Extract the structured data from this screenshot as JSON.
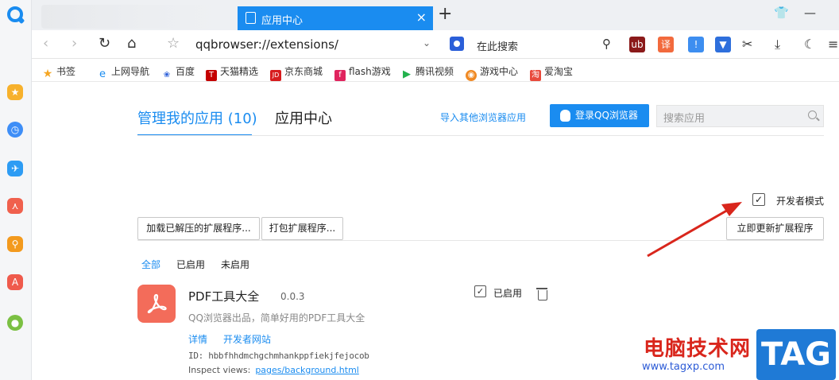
{
  "tab": {
    "title": "应用中心",
    "close": "×",
    "new_tab": "+"
  },
  "window_controls": {
    "skin": "👕",
    "minimize": "—"
  },
  "address": {
    "url": "qqbrowser://extensions/",
    "search_placeholder": "在此搜索",
    "dropdown": "⌄"
  },
  "toolbar": {
    "translate_label": "译"
  },
  "bookmarks": [
    {
      "label": "书签",
      "icon": "star-icon",
      "color": "#f5a623"
    },
    {
      "label": "上网导航",
      "icon": "e-icon",
      "color": "#1a8cf0"
    },
    {
      "label": "百度",
      "icon": "paw-icon",
      "color": "#2b5fd9"
    },
    {
      "label": "天猫精选",
      "icon": "tmall-icon",
      "color": "#c40000"
    },
    {
      "label": "京东商城",
      "icon": "jd-icon",
      "color": "#d71c1e"
    },
    {
      "label": "flash游戏",
      "icon": "flash-icon",
      "color": "#e0245e"
    },
    {
      "label": "腾讯视频",
      "icon": "play-icon",
      "color": "#23b14d"
    },
    {
      "label": "游戏中心",
      "icon": "gamepad-icon",
      "color": "#f08a24"
    },
    {
      "label": "爱淘宝",
      "icon": "taobao-icon",
      "color": "#e84a3c"
    }
  ],
  "manager": {
    "tab_manage": "管理我的应用 (10)",
    "tab_center": "应用中心",
    "import_link": "导入其他浏览器应用",
    "login_button": "登录QQ浏览器",
    "search_placeholder": "搜索应用",
    "developer_mode": {
      "label": "开发者模式",
      "checked": true,
      "mark": "✓"
    },
    "buttons": {
      "load_unpacked": "加载已解压的扩展程序...",
      "pack": "打包扩展程序...",
      "update": "立即更新扩展程序"
    },
    "filters": [
      {
        "label": "全部",
        "active": true
      },
      {
        "label": "已启用",
        "active": false
      },
      {
        "label": "未启用",
        "active": false
      }
    ],
    "extension": {
      "name": "PDF工具大全",
      "version": "0.0.3",
      "description": "QQ浏览器出品，简单好用的PDF工具大全",
      "details_link": "详情",
      "developer_link": "开发者网站",
      "id_line": "ID: hbbfhhdmchgchmhankppfiekjfejocob",
      "inspect_label": "Inspect views:",
      "inspect_link": "pages/background.html",
      "enabled_label": "已启用",
      "enabled_mark": "✓"
    }
  },
  "watermark": {
    "site_name": "电脑技术网",
    "url": "www.tagxp.com",
    "tag": "TAG"
  },
  "colors": {
    "accent": "#1a8cf0",
    "arrow": "#d9261c",
    "extension_icon": "#f36c5a"
  }
}
